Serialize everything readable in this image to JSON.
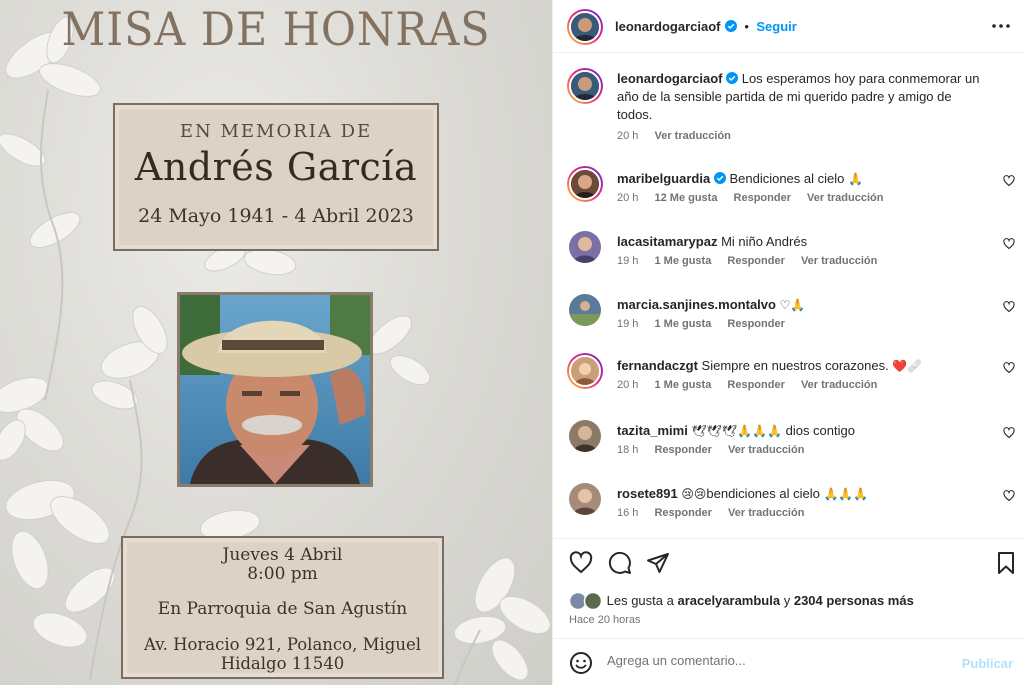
{
  "post_image": {
    "title": "MISA DE HONRAS",
    "memorial_label": "EN MEMORIA DE",
    "name": "Andrés García",
    "dates": "24 Mayo 1941 - 4 Abril 2023",
    "event_day": "Jueves 4 Abril",
    "event_time": "8:00 pm",
    "event_place": "En Parroquia de San Agustín",
    "event_address_1": "Av. Horacio 921, Polanco, Miguel",
    "event_address_2": "Hidalgo 11540"
  },
  "header": {
    "username": "leonardogarciaof",
    "separator": "•",
    "follow_label": "Seguir",
    "more_icon": "more-horizontal-icon"
  },
  "caption": {
    "username": "leonardogarciaof",
    "text": "Los esperamos hoy para conmemorar un año de la sensible partida de mi querido padre y amigo de todos.",
    "time": "20 h",
    "translate_label": "Ver traducción"
  },
  "comments": [
    {
      "username": "maribelguardia",
      "text": "Bendiciones al cielo",
      "emoji": "🙏",
      "time": "20 h",
      "likes": "12 Me gusta",
      "reply": "Responder",
      "translate": "Ver traducción",
      "avatar_color": "#6b4a3a"
    },
    {
      "username": "lacasitamarypaz",
      "text": "Mi niño Andrés",
      "emoji": "",
      "time": "19 h",
      "likes": "1 Me gusta",
      "reply": "Responder",
      "translate": "Ver traducción",
      "avatar_color": "#7b6fa6"
    },
    {
      "username": "marcia.sanjines.montalvo",
      "text": "",
      "emoji": "♡🙏",
      "time": "19 h",
      "likes": "1 Me gusta",
      "reply": "Responder",
      "translate": "",
      "avatar_color": "#5a7a9a"
    },
    {
      "username": "fernandaczgt",
      "text": "Siempre en nuestros corazones.",
      "emoji": "❤️🩹",
      "time": "20 h",
      "likes": "1 Me gusta",
      "reply": "Responder",
      "translate": "Ver traducción",
      "avatar_color": "#c9a07a"
    },
    {
      "username": "tazita_mimi",
      "text": "dios contigo",
      "emoji": "🕊🕊🕊🙏🙏🙏",
      "time": "18 h",
      "likes": "",
      "reply": "Responder",
      "translate": "Ver traducción",
      "avatar_color": "#8a7a66"
    },
    {
      "username": "rosete891",
      "text": "bendiciones al cielo",
      "emoji": "😢😢",
      "emoji_after": "🙏🙏🙏",
      "time": "16 h",
      "likes": "",
      "reply": "Responder",
      "translate": "Ver traducción",
      "avatar_color": "#a58b78"
    }
  ],
  "actions": {
    "like_icon": "heart-icon",
    "comment_icon": "comment-icon",
    "share_icon": "send-icon",
    "save_icon": "bookmark-icon",
    "liked_by_prefix": "Les gusta a",
    "liked_by_user": "aracelyarambula",
    "liked_by_connector": "y",
    "liked_by_others": "2304 personas más",
    "posted_ago": "Hace 20 horas"
  },
  "add_comment": {
    "emoji_icon": "smiley-icon",
    "placeholder": "Agrega un comentario...",
    "publish_label": "Publicar"
  },
  "colors": {
    "accent": "#0095f6",
    "muted": "#737373",
    "border": "#efefef",
    "card_bg": "#dcd2c5",
    "title_brown": "#847261"
  }
}
